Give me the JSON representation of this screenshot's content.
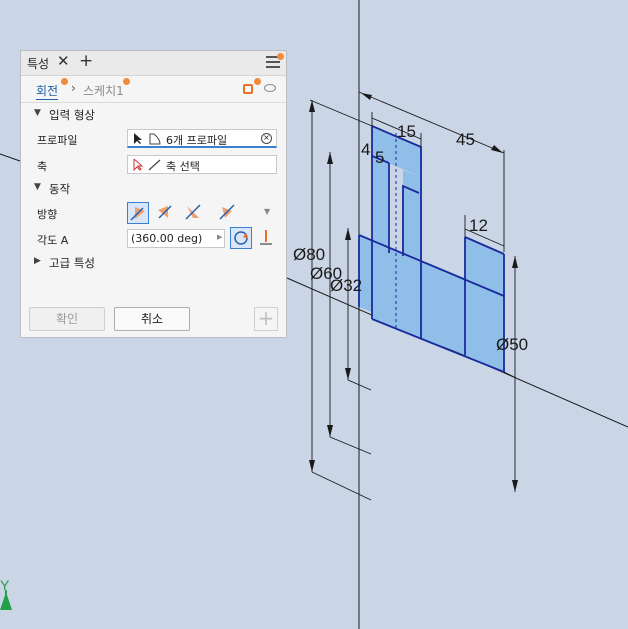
{
  "panel": {
    "tab_title": "특성",
    "tab_close": "✕",
    "tab_add": "+",
    "crumb_active": "회전",
    "crumb_sep": "›",
    "crumb_sketch": "스케치1",
    "sections": {
      "input_geometry": "입력 형상",
      "behavior": "동작",
      "advanced": "고급 특성"
    },
    "rows": {
      "profile_label": "프로파일",
      "profile_value": "6개 프로파일",
      "axis_label": "축",
      "axis_value": "축 선택",
      "direction_label": "방향",
      "angle_label": "각도 A",
      "angle_value": "(360.00 deg)"
    },
    "buttons": {
      "ok": "확인",
      "cancel": "취소",
      "add": "+"
    }
  },
  "dimensions": {
    "d15": "15",
    "d45": "45",
    "d4": "4",
    "d5": "5",
    "d12": "12",
    "dia80": "Ø80",
    "dia60": "Ø60",
    "dia32": "Ø32",
    "dia50": "Ø50"
  },
  "triad": {
    "y_label": "Y"
  },
  "colors": {
    "background": "#cad6e6",
    "profile_fill": "#8fbfe9",
    "profile_edge": "#1a2a9c",
    "accent_orange": "#f08a3c",
    "selection_blue": "#3a7fd0"
  }
}
